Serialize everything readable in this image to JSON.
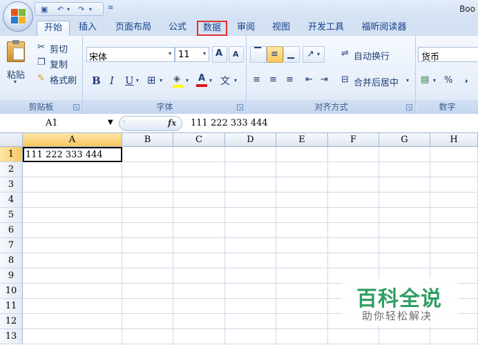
{
  "window": {
    "title": "Boo"
  },
  "tabs": [
    {
      "label": "开始"
    },
    {
      "label": "插入"
    },
    {
      "label": "页面布局"
    },
    {
      "label": "公式"
    },
    {
      "label": "数据"
    },
    {
      "label": "审阅"
    },
    {
      "label": "视图"
    },
    {
      "label": "开发工具"
    },
    {
      "label": "福昕阅读器"
    }
  ],
  "clipboard": {
    "paste": "粘贴",
    "cut": "剪切",
    "copy": "复制",
    "format_painter": "格式刷",
    "label": "剪贴板"
  },
  "font": {
    "name": "宋体",
    "size": "11",
    "bold": "B",
    "italic": "I",
    "underline": "U",
    "font_color_glyph": "A",
    "phonetic_glyph": "文",
    "grow_glyph": "A",
    "shrink_glyph": "A",
    "label": "字体"
  },
  "alignment": {
    "wrap_text": "自动换行",
    "merge_center": "合并后居中",
    "label": "对齐方式"
  },
  "number": {
    "format": "货币",
    "percent": "%",
    "comma": ",",
    "label": "数字"
  },
  "formula_bar": {
    "name_box": "A1",
    "fx": "fx",
    "value": "111 222 333 444"
  },
  "columns": [
    "A",
    "B",
    "C",
    "D",
    "E",
    "F",
    "G",
    "H"
  ],
  "rows": [
    "1",
    "2",
    "3",
    "4",
    "5",
    "6",
    "7",
    "8",
    "9",
    "10",
    "11",
    "12",
    "13"
  ],
  "cells": {
    "A1": "111 222 333 444"
  },
  "watermark": {
    "title": "百科全说",
    "subtitle": "助你轻松解决"
  },
  "colors": {
    "accent": "#15428b",
    "highlight_border": "#e0312e",
    "selected_header": "#f7c661",
    "watermark_green": "#2f9e62"
  }
}
